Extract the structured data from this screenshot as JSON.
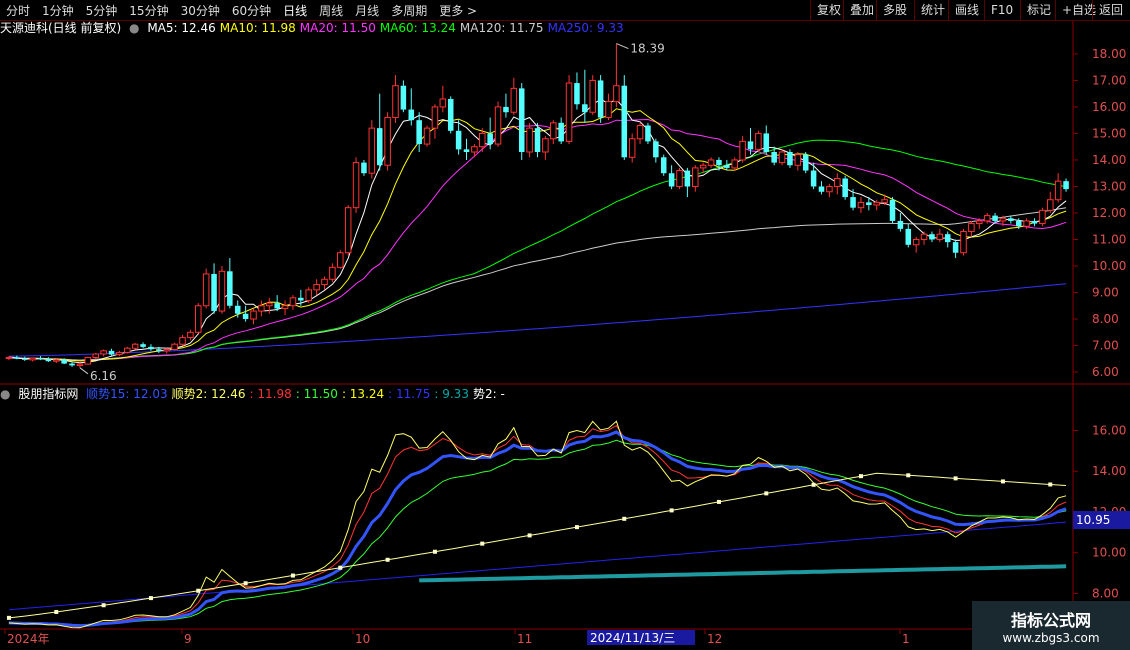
{
  "toolbar": {
    "tabs": [
      "分时",
      "1分钟",
      "5分钟",
      "15分钟",
      "30分钟",
      "60分钟",
      "日线",
      "周线",
      "月线",
      "多周期",
      "更多 >"
    ],
    "active_tab": "日线",
    "right_buttons": [
      "复权",
      "叠加",
      "多股",
      "统计",
      "画线",
      "F10",
      "标记",
      "+自选",
      "返回"
    ]
  },
  "main_panel": {
    "stock_title": "天源迪科(日线 前复权)",
    "ma_labels": [
      {
        "text": "MA5: 12.46",
        "color": "#ffffff"
      },
      {
        "text": "MA10: 11.98",
        "color": "#ffff00"
      },
      {
        "text": "MA20: 11.50",
        "color": "#ff33ff"
      },
      {
        "text": "MA60: 13.24",
        "color": "#00ff00"
      },
      {
        "text": "MA120: 11.75",
        "color": "#cccccc"
      },
      {
        "text": "MA250: 9.33",
        "color": "#3333ff"
      }
    ],
    "high_marker": "18.39",
    "low_marker": "6.16",
    "y_ticks": [
      "18.00",
      "17.00",
      "16.00",
      "15.00",
      "14.00",
      "13.00",
      "12.00",
      "11.00",
      "10.00",
      "9.00",
      "8.00",
      "7.00",
      "6.00"
    ]
  },
  "indicator_panel": {
    "title": "股朋指标网",
    "labels": [
      {
        "text": "顺势15: 12.03",
        "color": "#3355ff"
      },
      {
        "text": "顺势2: 12.46",
        "color": "#ffff66"
      },
      {
        "text": ": 11.98",
        "color": "#ff3333"
      },
      {
        "text": ": 11.50",
        "color": "#33ff33"
      },
      {
        "text": ": 13.24",
        "color": "#ffff00"
      },
      {
        "text": ": 11.75",
        "color": "#3333ff"
      },
      {
        "text": ": 9.33",
        "color": "#00aaaa"
      },
      {
        "text": "势2: -",
        "color": "#ffffff"
      }
    ],
    "y_ticks": [
      "16.00",
      "14.00",
      "12.00",
      "10.00",
      "8.00"
    ],
    "current_value": "10.95"
  },
  "x_axis": {
    "labels": [
      "2024年",
      "9",
      "10",
      "11",
      "12",
      "1"
    ],
    "cursor_date": "2024/11/13/三"
  },
  "watermark": {
    "line1": "指标公式网",
    "line2": "www.zbgs3.com"
  },
  "chart_data": {
    "type": "candlestick",
    "ohlc": [
      [
        6.52,
        6.6,
        6.45,
        6.55
      ],
      [
        6.55,
        6.62,
        6.48,
        6.5
      ],
      [
        6.5,
        6.58,
        6.42,
        6.46
      ],
      [
        6.46,
        6.55,
        6.4,
        6.52
      ],
      [
        6.52,
        6.6,
        6.45,
        6.49
      ],
      [
        6.49,
        6.56,
        6.38,
        6.41
      ],
      [
        6.41,
        6.5,
        6.34,
        6.46
      ],
      [
        6.46,
        6.52,
        6.3,
        6.32
      ],
      [
        6.32,
        6.4,
        6.2,
        6.25
      ],
      [
        6.25,
        6.35,
        6.16,
        6.3
      ],
      [
        6.3,
        6.58,
        6.28,
        6.55
      ],
      [
        6.55,
        6.72,
        6.5,
        6.68
      ],
      [
        6.68,
        6.85,
        6.6,
        6.8
      ],
      [
        6.8,
        6.88,
        6.62,
        6.66
      ],
      [
        6.66,
        6.8,
        6.6,
        6.74
      ],
      [
        6.74,
        6.95,
        6.7,
        6.9
      ],
      [
        6.9,
        7.1,
        6.85,
        7.05
      ],
      [
        7.05,
        7.12,
        6.9,
        6.95
      ],
      [
        6.95,
        7.05,
        6.8,
        6.86
      ],
      [
        6.86,
        6.95,
        6.72,
        6.8
      ],
      [
        6.8,
        6.9,
        6.7,
        6.85
      ],
      [
        6.85,
        7.1,
        6.82,
        7.05
      ],
      [
        7.05,
        7.4,
        7.0,
        7.3
      ],
      [
        7.3,
        7.6,
        7.2,
        7.5
      ],
      [
        7.5,
        8.6,
        7.45,
        8.5
      ],
      [
        8.5,
        9.9,
        8.4,
        9.7
      ],
      [
        9.7,
        10.1,
        8.2,
        8.3
      ],
      [
        8.3,
        10.0,
        8.2,
        9.8
      ],
      [
        9.8,
        10.3,
        8.4,
        8.5
      ],
      [
        8.5,
        8.7,
        8.05,
        8.2
      ],
      [
        8.2,
        8.5,
        7.9,
        8.0
      ],
      [
        8.0,
        8.4,
        7.8,
        8.3
      ],
      [
        8.3,
        8.7,
        8.1,
        8.5
      ],
      [
        8.5,
        8.8,
        8.2,
        8.6
      ],
      [
        8.6,
        8.9,
        8.3,
        8.4
      ],
      [
        8.4,
        8.7,
        8.15,
        8.5
      ],
      [
        8.5,
        8.9,
        8.35,
        8.8
      ],
      [
        8.8,
        9.1,
        8.5,
        8.7
      ],
      [
        8.7,
        9.2,
        8.6,
        9.1
      ],
      [
        9.1,
        9.5,
        8.9,
        9.3
      ],
      [
        9.3,
        9.6,
        9.1,
        9.5
      ],
      [
        9.5,
        10.1,
        9.4,
        9.95
      ],
      [
        9.95,
        10.6,
        9.9,
        10.5
      ],
      [
        10.5,
        12.3,
        10.4,
        12.2
      ],
      [
        12.2,
        14.1,
        12.0,
        13.9
      ],
      [
        13.9,
        14.0,
        13.4,
        13.5
      ],
      [
        13.5,
        15.5,
        13.3,
        15.2
      ],
      [
        15.2,
        16.5,
        13.6,
        13.8
      ],
      [
        13.8,
        15.8,
        13.6,
        15.6
      ],
      [
        15.6,
        17.2,
        15.4,
        16.8
      ],
      [
        16.8,
        17.0,
        15.8,
        15.9
      ],
      [
        15.9,
        16.7,
        15.3,
        15.5
      ],
      [
        15.5,
        15.8,
        14.3,
        14.6
      ],
      [
        14.6,
        15.3,
        14.5,
        15.2
      ],
      [
        15.2,
        16.1,
        14.8,
        16.0
      ],
      [
        16.0,
        16.8,
        15.8,
        16.3
      ],
      [
        16.3,
        16.4,
        15.0,
        15.1
      ],
      [
        15.1,
        15.5,
        14.2,
        14.4
      ],
      [
        14.4,
        14.8,
        14.0,
        14.3
      ],
      [
        14.3,
        14.6,
        14.1,
        14.5
      ],
      [
        14.5,
        15.2,
        14.3,
        15.0
      ],
      [
        15.0,
        15.6,
        14.4,
        14.6
      ],
      [
        14.6,
        16.2,
        14.5,
        16.0
      ],
      [
        16.0,
        16.5,
        15.6,
        15.8
      ],
      [
        15.8,
        17.1,
        15.7,
        16.7
      ],
      [
        16.7,
        16.9,
        14.0,
        14.3
      ],
      [
        14.3,
        15.4,
        14.1,
        15.2
      ],
      [
        15.2,
        15.4,
        14.1,
        14.3
      ],
      [
        14.3,
        14.9,
        14.0,
        14.8
      ],
      [
        14.8,
        15.5,
        14.6,
        15.4
      ],
      [
        15.4,
        15.6,
        14.6,
        14.7
      ],
      [
        14.7,
        17.2,
        14.6,
        16.9
      ],
      [
        16.9,
        17.3,
        15.9,
        16.1
      ],
      [
        16.1,
        17.4,
        15.4,
        15.8
      ],
      [
        15.8,
        17.2,
        15.7,
        17.0
      ],
      [
        17.0,
        17.2,
        15.4,
        15.6
      ],
      [
        15.6,
        16.5,
        15.5,
        16.2
      ],
      [
        16.2,
        18.39,
        16.0,
        16.8
      ],
      [
        16.8,
        17.2,
        14.0,
        14.1
      ],
      [
        14.1,
        15.0,
        13.9,
        14.8
      ],
      [
        14.8,
        15.4,
        14.6,
        15.3
      ],
      [
        15.3,
        15.4,
        14.6,
        14.7
      ],
      [
        14.7,
        14.8,
        13.9,
        14.1
      ],
      [
        14.1,
        14.2,
        13.4,
        13.5
      ],
      [
        13.5,
        13.8,
        12.9,
        13.0
      ],
      [
        13.0,
        13.7,
        12.9,
        13.6
      ],
      [
        13.6,
        13.7,
        12.6,
        13.0
      ],
      [
        13.0,
        13.8,
        12.8,
        13.7
      ],
      [
        13.7,
        13.9,
        13.5,
        13.8
      ],
      [
        13.8,
        14.1,
        13.7,
        14.0
      ],
      [
        14.0,
        14.1,
        13.6,
        13.8
      ],
      [
        13.8,
        14.0,
        13.6,
        13.7
      ],
      [
        13.7,
        14.1,
        13.6,
        14.0
      ],
      [
        14.0,
        14.9,
        13.9,
        14.7
      ],
      [
        14.7,
        15.2,
        14.2,
        14.4
      ],
      [
        14.4,
        15.1,
        14.3,
        15.0
      ],
      [
        15.0,
        15.3,
        14.2,
        14.3
      ],
      [
        14.3,
        14.5,
        13.8,
        13.9
      ],
      [
        13.9,
        14.4,
        13.8,
        14.3
      ],
      [
        14.3,
        14.4,
        13.7,
        13.8
      ],
      [
        13.8,
        14.3,
        13.6,
        14.2
      ],
      [
        14.2,
        14.3,
        13.5,
        13.6
      ],
      [
        13.6,
        13.9,
        12.9,
        13.0
      ],
      [
        13.0,
        13.2,
        12.7,
        12.8
      ],
      [
        12.8,
        13.1,
        12.6,
        13.0
      ],
      [
        13.0,
        13.5,
        12.7,
        13.3
      ],
      [
        13.3,
        13.4,
        12.5,
        12.6
      ],
      [
        12.6,
        12.9,
        12.1,
        12.2
      ],
      [
        12.2,
        12.6,
        12.0,
        12.4
      ],
      [
        12.4,
        12.6,
        12.1,
        12.3
      ],
      [
        12.3,
        12.5,
        12.1,
        12.4
      ],
      [
        12.4,
        12.7,
        12.3,
        12.5
      ],
      [
        12.5,
        12.6,
        11.6,
        11.7
      ],
      [
        11.7,
        12.0,
        11.3,
        11.4
      ],
      [
        11.4,
        11.6,
        10.7,
        10.8
      ],
      [
        10.8,
        11.1,
        10.5,
        11.0
      ],
      [
        11.0,
        11.3,
        10.8,
        11.2
      ],
      [
        11.2,
        11.3,
        10.9,
        11.0
      ],
      [
        11.0,
        11.4,
        10.9,
        11.2
      ],
      [
        11.2,
        11.3,
        10.7,
        10.9
      ],
      [
        10.9,
        11.0,
        10.3,
        10.5
      ],
      [
        10.5,
        11.4,
        10.4,
        11.3
      ],
      [
        11.3,
        11.7,
        11.1,
        11.6
      ],
      [
        11.6,
        11.8,
        11.4,
        11.7
      ],
      [
        11.7,
        12.0,
        11.6,
        11.9
      ],
      [
        11.9,
        12.0,
        11.6,
        11.7
      ],
      [
        11.7,
        11.9,
        11.5,
        11.8
      ],
      [
        11.8,
        11.9,
        11.6,
        11.7
      ],
      [
        11.7,
        11.8,
        11.4,
        11.5
      ],
      [
        11.5,
        11.8,
        11.4,
        11.7
      ],
      [
        11.7,
        11.8,
        11.5,
        11.6
      ],
      [
        11.6,
        12.2,
        11.5,
        12.1
      ],
      [
        12.1,
        12.8,
        12.0,
        12.5
      ],
      [
        12.5,
        13.5,
        12.4,
        13.2
      ],
      [
        13.2,
        13.3,
        12.8,
        12.9
      ]
    ],
    "indicator": "股朋指标网",
    "y_range_main": [
      5.7,
      18.6
    ],
    "y_range_indicator": [
      6.4,
      17.4
    ]
  }
}
